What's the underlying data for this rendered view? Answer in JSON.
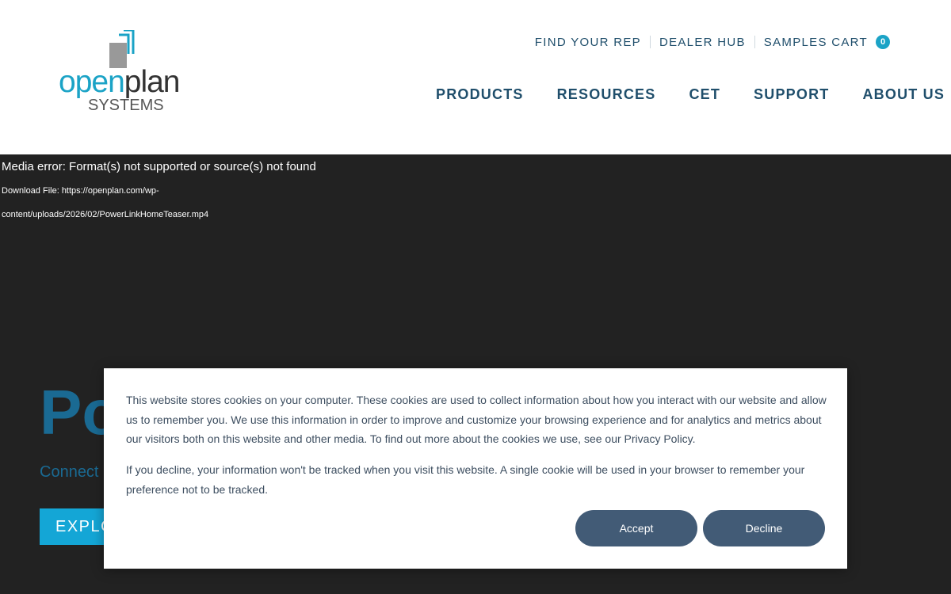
{
  "brand": {
    "logo_word_open": "open",
    "logo_word_plan": "plan",
    "logo_sub": "SYSTEMS",
    "accent_color": "#1ba3c6",
    "nav_color": "#1f4e6b"
  },
  "top_links": {
    "find_rep": "FIND YOUR REP",
    "dealer_hub": "DEALER HUB",
    "samples_cart": "SAMPLES CART",
    "cart_count": "0"
  },
  "main_nav": {
    "products": "PRODUCTS",
    "resources": "RESOURCES",
    "cet": "CET",
    "support": "SUPPORT",
    "about": "ABOUT US"
  },
  "hero": {
    "media_error": "Media error: Format(s) not supported or source(s) not found",
    "download_line1": "Download File: https://openplan.com/wp-",
    "download_line2": "content/uploads/2026/02/PowerLinkHomeTeaser.mp4",
    "title_visible": "Po",
    "subtitle_visible": "Connect",
    "button_visible": "EXPLO"
  },
  "cookie": {
    "paragraph1": "This website stores cookies on your computer. These cookies are used to collect information about how you interact with our website and allow us to remember you. We use this information in order to improve and customize your browsing experience and for analytics and metrics about our visitors both on this website and other media. To find out more about the cookies we use, see our Privacy Policy.",
    "paragraph2": "If you decline, your information won't be tracked when you visit this website. A single cookie will be used in your browser to remember your preference not to be tracked.",
    "accept_label": "Accept",
    "decline_label": "Decline",
    "button_color": "#425b76"
  }
}
